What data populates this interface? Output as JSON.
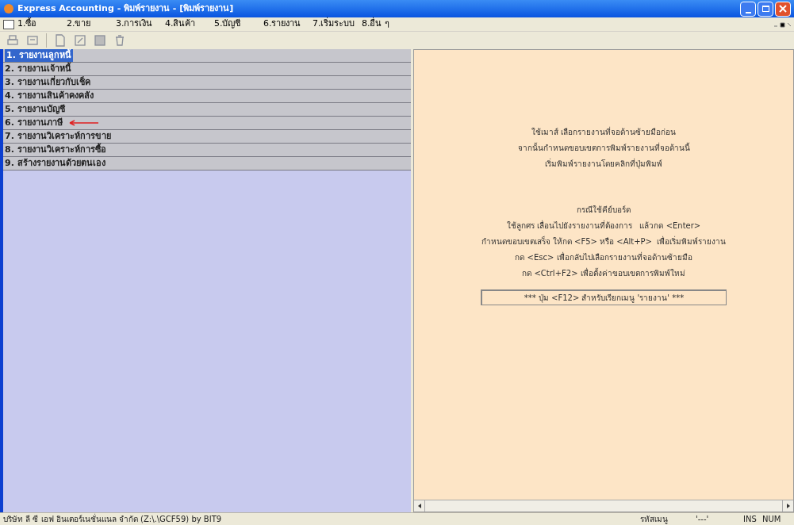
{
  "window": {
    "title": "Express Accounting - พิมพ์รายงาน - [พิมพ์รายงาน]"
  },
  "menu": [
    {
      "label": "1.ซื้อ"
    },
    {
      "label": "2.ขาย"
    },
    {
      "label": "3.การเงิน"
    },
    {
      "label": "4.สินค้า"
    },
    {
      "label": "5.บัญชี"
    },
    {
      "label": "6.รายงาน"
    },
    {
      "label": "7.เริ่มระบบ"
    },
    {
      "label": "8.อื่น ๆ"
    }
  ],
  "reports": [
    {
      "label": "1. รายงานลูกหนี้",
      "selected": true,
      "marked": false
    },
    {
      "label": "2. รายงานเจ้าหนี้",
      "selected": false,
      "marked": false
    },
    {
      "label": "3. รายงานเกี่ยวกับเช็ค",
      "selected": false,
      "marked": false
    },
    {
      "label": "4. รายงานสินค้าคงคลัง",
      "selected": false,
      "marked": false
    },
    {
      "label": "5. รายงานบัญชี",
      "selected": false,
      "marked": false
    },
    {
      "label": "6. รายงานภาษี",
      "selected": false,
      "marked": true
    },
    {
      "label": "7. รายงานวิเคราะห์การขาย",
      "selected": false,
      "marked": false
    },
    {
      "label": "8. รายงานวิเคราะห์การซื้อ",
      "selected": false,
      "marked": false
    },
    {
      "label": "9. สร้างรายงานด้วยตนเอง",
      "selected": false,
      "marked": false
    }
  ],
  "help": {
    "mouse": [
      "ใช้เมาส์ เลือกรายงานที่จอด้านซ้ายมือก่อน",
      "จากนั้นกำหนดขอบเขตการพิมพ์รายงานที่จอด้านนี้",
      "เริ่มพิมพ์รายงานโดยคลิกที่ปุ่มพิมพ์"
    ],
    "keyboard_heading": "กรณีใช้คีย์บอร์ด",
    "keyboard": [
      "ใช้ลูกศร เลื่อนไปยังรายงานที่ต้องการ   แล้วกด <Enter>",
      "กำหนดขอบเขตเสร็จ ให้กด <F5> หรือ <Alt+P>  เพื่อเริ่มพิมพ์รายงาน",
      "กด <Esc> เพื่อกลับไปเลือกรายงานที่จอด้านซ้ายมือ",
      "กด <Ctrl+F2> เพื่อตั้งค่าขอบเขตการพิมพ์ใหม่"
    ],
    "hint": "*** ปุ่ม <F12> สำหรับเรียกเมนู 'รายงาน' ***"
  },
  "status_bar": {
    "company": "บริษัท ลี ซี เอฟ อินเตอร์เนชั่นแนล จำกัด (Z:\\.\\GCF59) by BIT9",
    "menu_code": "รหัสเมนู",
    "code": "'---'",
    "ins": "INS",
    "num": "NUM"
  }
}
